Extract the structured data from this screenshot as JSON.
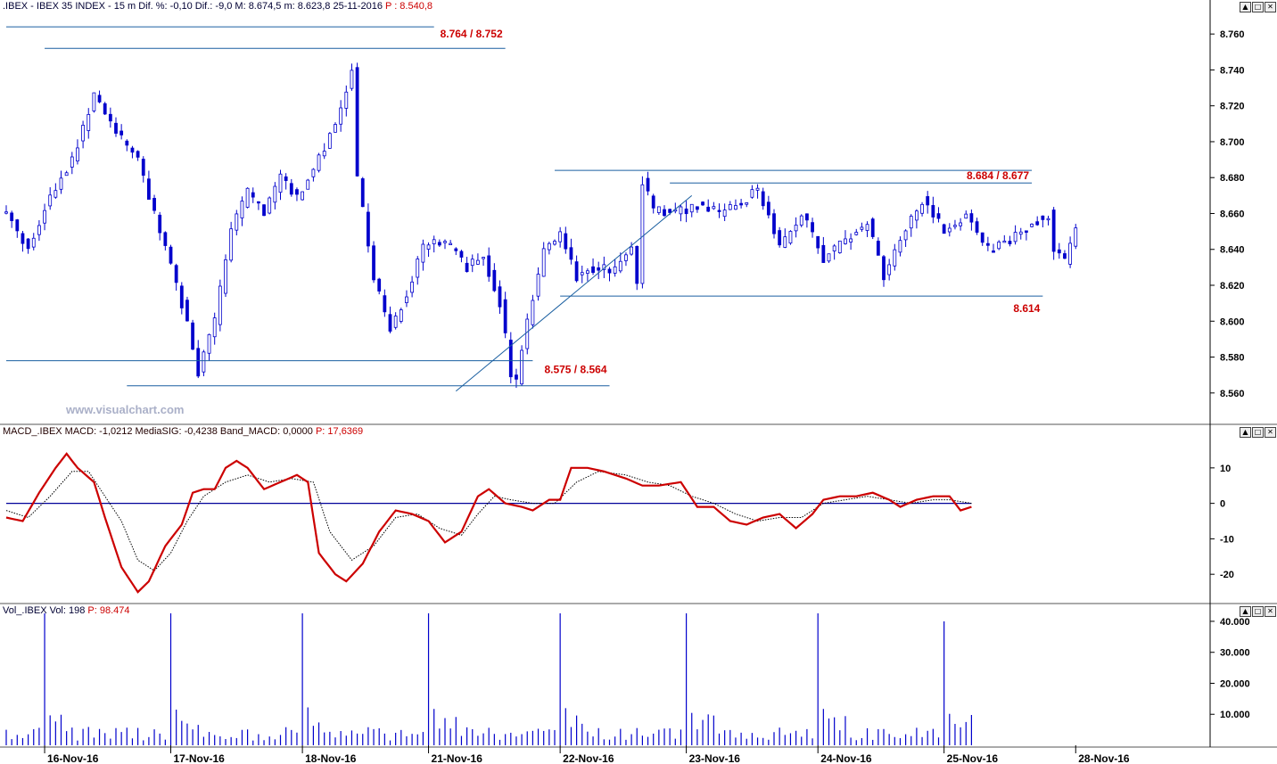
{
  "header": {
    "price_info": ".IBEX - IBEX 35 INDEX - 15 m Dif. %: -0,10 Dif.: -9,0 M: 8.674,5 m: 8.623,8 25-11-2016",
    "price_last": "P : 8.540,8",
    "macd_info": "MACD_.IBEX MACD: -1,0212 MediaSIG: -0,4238 Band_MACD: 0,0000",
    "macd_last": "P: 17,6369",
    "vol_info": "Vol_.IBEX Vol: 198",
    "vol_last": "P: 98.474"
  },
  "watermark": "www.visualchart.com",
  "window_buttons": [
    "▲",
    "□",
    "✕"
  ],
  "colors": {
    "candle": "#0000cc",
    "level_line": "#1a5fa0",
    "level_label": "#cc0000",
    "macd": "#cc0000",
    "signal": "#000000",
    "zero_line": "#000099"
  },
  "chart_data": [
    {
      "type": "candlestick",
      "name": "price",
      "ylim": [
        8545,
        8772
      ],
      "yticks": [
        "8.760",
        "8.740",
        "8.720",
        "8.700",
        "8.680",
        "8.660",
        "8.640",
        "8.620",
        "8.600",
        "8.580",
        "8.560"
      ],
      "ytick_values": [
        8760,
        8740,
        8720,
        8700,
        8680,
        8660,
        8640,
        8620,
        8600,
        8580,
        8560
      ],
      "categories": [
        "16-Nov-16",
        "17-Nov-16",
        "18-Nov-16",
        "21-Nov-16",
        "22-Nov-16",
        "23-Nov-16",
        "24-Nov-16",
        "25-Nov-16",
        "28-Nov-16"
      ],
      "close_anchors": [
        [
          0,
          8660
        ],
        [
          4,
          8640
        ],
        [
          8,
          8670
        ],
        [
          12,
          8690
        ],
        [
          16,
          8725
        ],
        [
          20,
          8705
        ],
        [
          24,
          8690
        ],
        [
          28,
          8650
        ],
        [
          32,
          8610
        ],
        [
          35,
          8572
        ],
        [
          38,
          8600
        ],
        [
          41,
          8650
        ],
        [
          44,
          8672
        ],
        [
          47,
          8660
        ],
        [
          50,
          8680
        ],
        [
          53,
          8668
        ],
        [
          56,
          8685
        ],
        [
          60,
          8710
        ],
        [
          63,
          8740
        ],
        [
          64,
          8680
        ],
        [
          67,
          8625
        ],
        [
          70,
          8595
        ],
        [
          73,
          8615
        ],
        [
          76,
          8640
        ],
        [
          80,
          8645
        ],
        [
          84,
          8630
        ],
        [
          87,
          8635
        ],
        [
          90,
          8610
        ],
        [
          92,
          8572
        ],
        [
          93,
          8566
        ],
        [
          95,
          8600
        ],
        [
          98,
          8640
        ],
        [
          101,
          8648
        ],
        [
          104,
          8625
        ],
        [
          107,
          8630
        ],
        [
          111,
          8628
        ],
        [
          114,
          8640
        ],
        [
          115,
          8623
        ],
        [
          116,
          8678
        ],
        [
          118,
          8662
        ],
        [
          122,
          8660
        ],
        [
          126,
          8665
        ],
        [
          130,
          8660
        ],
        [
          134,
          8665
        ],
        [
          137,
          8674
        ],
        [
          139,
          8660
        ],
        [
          141,
          8640
        ],
        [
          145,
          8660
        ],
        [
          149,
          8635
        ],
        [
          153,
          8645
        ],
        [
          157,
          8655
        ],
        [
          160,
          8625
        ],
        [
          164,
          8650
        ],
        [
          167,
          8668
        ],
        [
          171,
          8650
        ],
        [
          175,
          8660
        ],
        [
          179,
          8640
        ],
        [
          183,
          8645
        ],
        [
          187,
          8655
        ],
        [
          190,
          8660
        ],
        [
          191,
          8640
        ],
        [
          193,
          8632
        ],
        [
          195,
          8650
        ]
      ],
      "annotations": [
        "8.764 / 8.752",
        "8.684 / 8.677",
        "8.614",
        "8.575 / 8.564"
      ],
      "levels": [
        {
          "value": 8764,
          "from": 0,
          "to": 78
        },
        {
          "value": 8752,
          "from": 7,
          "to": 91
        },
        {
          "value": 8684,
          "from": 100,
          "to": 187
        },
        {
          "value": 8677,
          "from": 121,
          "to": 187
        },
        {
          "value": 8614,
          "from": 101,
          "to": 189
        },
        {
          "value": 8578,
          "from": 0,
          "to": 96
        },
        {
          "value": 8564,
          "from": 22,
          "to": 110
        }
      ],
      "trendline": [
        [
          82,
          8561
        ],
        [
          125,
          8670
        ]
      ]
    },
    {
      "type": "line",
      "name": "macd",
      "ylim": [
        -28,
        17
      ],
      "yticks": [
        "10",
        "0",
        "-10",
        "-20"
      ],
      "ytick_values": [
        10,
        0,
        -10,
        -20
      ],
      "series": [
        {
          "values_anchor": [
            [
              0,
              -4
            ],
            [
              3,
              -5
            ],
            [
              6,
              3
            ],
            [
              9,
              10
            ],
            [
              11,
              14
            ],
            [
              13,
              10
            ],
            [
              16,
              6
            ],
            [
              18,
              -4
            ],
            [
              21,
              -18
            ],
            [
              24,
              -25
            ],
            [
              26,
              -22
            ],
            [
              29,
              -12
            ],
            [
              32,
              -6
            ],
            [
              34,
              3
            ],
            [
              36,
              4
            ],
            [
              38,
              4
            ],
            [
              40,
              10
            ],
            [
              42,
              12
            ],
            [
              44,
              10
            ],
            [
              47,
              4
            ],
            [
              50,
              6
            ],
            [
              53,
              8
            ],
            [
              55,
              6
            ],
            [
              57,
              -14
            ],
            [
              60,
              -20
            ],
            [
              62,
              -22
            ],
            [
              65,
              -17
            ],
            [
              68,
              -8
            ],
            [
              71,
              -2
            ],
            [
              74,
              -3
            ],
            [
              77,
              -5
            ],
            [
              80,
              -11
            ],
            [
              83,
              -8
            ],
            [
              86,
              2
            ],
            [
              88,
              4
            ],
            [
              91,
              0
            ],
            [
              94,
              -1
            ],
            [
              96,
              -2
            ],
            [
              99,
              1
            ],
            [
              101,
              1
            ],
            [
              103,
              10
            ],
            [
              106,
              10
            ],
            [
              109,
              9
            ],
            [
              113,
              7
            ],
            [
              116,
              5
            ],
            [
              119,
              5
            ],
            [
              123,
              6
            ],
            [
              126,
              -1
            ],
            [
              129,
              -1
            ],
            [
              132,
              -5
            ],
            [
              135,
              -6
            ],
            [
              138,
              -4
            ],
            [
              141,
              -3
            ],
            [
              144,
              -7
            ],
            [
              147,
              -3
            ],
            [
              149,
              1
            ],
            [
              152,
              2
            ],
            [
              155,
              2
            ],
            [
              158,
              3
            ],
            [
              161,
              1
            ],
            [
              163,
              -1
            ],
            [
              166,
              1
            ],
            [
              169,
              2
            ],
            [
              172,
              2
            ],
            [
              174,
              -2
            ],
            [
              176,
              -1
            ]
          ]
        },
        {
          "values_anchor": [
            [
              0,
              -2
            ],
            [
              4,
              -4
            ],
            [
              8,
              2
            ],
            [
              12,
              9
            ],
            [
              15,
              9
            ],
            [
              18,
              2
            ],
            [
              21,
              -5
            ],
            [
              24,
              -16
            ],
            [
              27,
              -19
            ],
            [
              30,
              -14
            ],
            [
              33,
              -5
            ],
            [
              36,
              2
            ],
            [
              40,
              6
            ],
            [
              44,
              8
            ],
            [
              48,
              6
            ],
            [
              52,
              7
            ],
            [
              56,
              6
            ],
            [
              59,
              -8
            ],
            [
              63,
              -16
            ],
            [
              67,
              -12
            ],
            [
              71,
              -4
            ],
            [
              75,
              -3
            ],
            [
              79,
              -7
            ],
            [
              83,
              -9
            ],
            [
              86,
              -3
            ],
            [
              89,
              2
            ],
            [
              92,
              1
            ],
            [
              96,
              0
            ],
            [
              100,
              0
            ],
            [
              104,
              6
            ],
            [
              108,
              9
            ],
            [
              113,
              8
            ],
            [
              117,
              6
            ],
            [
              121,
              5
            ],
            [
              125,
              2
            ],
            [
              129,
              0
            ],
            [
              133,
              -3
            ],
            [
              137,
              -5
            ],
            [
              141,
              -4
            ],
            [
              145,
              -4
            ],
            [
              149,
              0
            ],
            [
              153,
              1
            ],
            [
              157,
              2
            ],
            [
              161,
              1
            ],
            [
              165,
              0
            ],
            [
              169,
              1
            ],
            [
              172,
              1
            ],
            [
              176,
              0
            ]
          ]
        }
      ]
    },
    {
      "type": "bar",
      "name": "volume",
      "ylim": [
        0,
        42000
      ],
      "yticks": [
        "40.000",
        "30.000",
        "20.000",
        "10.000"
      ],
      "ytick_values": [
        40000,
        30000,
        20000,
        10000
      ],
      "spike_values": [
        43000,
        43000,
        43000,
        43000,
        43000,
        43000,
        43000,
        40000
      ]
    }
  ]
}
